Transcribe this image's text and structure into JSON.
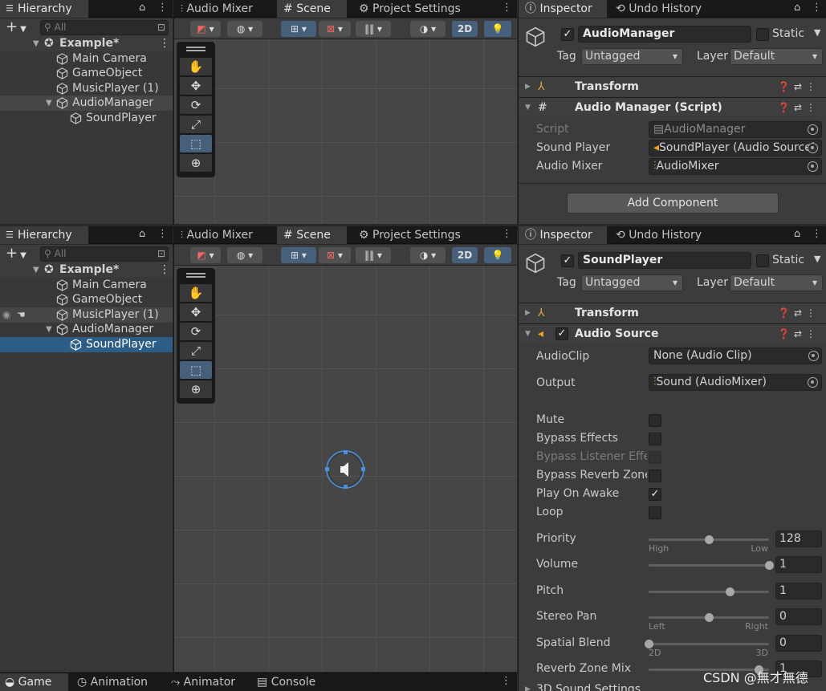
{
  "tabs": {
    "hierarchy": "Hierarchy",
    "audio_mixer": "Audio Mixer",
    "scene": "Scene",
    "project_settings": "Project Settings",
    "inspector": "Inspector",
    "undo_history": "Undo History"
  },
  "hierarchy": {
    "search_placeholder": "All",
    "scene_name": "Example*",
    "items": [
      "Main Camera",
      "GameObject",
      "MusicPlayer (1)",
      "AudioManager",
      "SoundPlayer"
    ]
  },
  "scene_toolbar": {
    "mode_2d": "2D"
  },
  "top_inspector": {
    "object_name": "AudioManager",
    "static_label": "Static",
    "tag_label": "Tag",
    "tag_value": "Untagged",
    "layer_label": "Layer",
    "layer_value": "Default",
    "components": {
      "transform": "Transform",
      "script": "Audio Manager (Script)"
    },
    "props": [
      {
        "label": "Script",
        "value": "AudioManager"
      },
      {
        "label": "Sound Player",
        "value": "SoundPlayer (Audio Source)"
      },
      {
        "label": "Audio Mixer",
        "value": "AudioMixer"
      }
    ],
    "add_component": "Add Component"
  },
  "bottom_inspector": {
    "object_name": "SoundPlayer",
    "static_label": "Static",
    "tag_label": "Tag",
    "tag_value": "Untagged",
    "layer_label": "Layer",
    "layer_value": "Default",
    "components": {
      "transform": "Transform",
      "audio_source": "Audio Source",
      "sound_3d": "3D Sound Settings"
    },
    "audio_clip": {
      "label": "AudioClip",
      "value": "None (Audio Clip)"
    },
    "output": {
      "label": "Output",
      "value": "Sound (AudioMixer)"
    },
    "toggles": [
      {
        "label": "Mute",
        "checked": false
      },
      {
        "label": "Bypass Effects",
        "checked": false
      },
      {
        "label": "Bypass Listener Effects",
        "checked": false
      },
      {
        "label": "Bypass Reverb Zones",
        "checked": false
      },
      {
        "label": "Play On Awake",
        "checked": true
      },
      {
        "label": "Loop",
        "checked": false
      }
    ],
    "sliders": {
      "priority": {
        "label": "Priority",
        "value": "128",
        "fraction": 0.5,
        "min_label": "High",
        "max_label": "Low"
      },
      "volume": {
        "label": "Volume",
        "value": "1",
        "fraction": 1.0
      },
      "pitch": {
        "label": "Pitch",
        "value": "1",
        "fraction": 0.67
      },
      "stereo_pan": {
        "label": "Stereo Pan",
        "value": "0",
        "fraction": 0.5,
        "min_label": "Left",
        "max_label": "Right"
      },
      "spatial_blend": {
        "label": "Spatial Blend",
        "value": "0",
        "fraction": 0.0,
        "min_label": "2D",
        "max_label": "3D"
      },
      "reverb_zone_mix": {
        "label": "Reverb Zone Mix",
        "value": "1",
        "fraction": 0.91
      }
    }
  },
  "bottom_tabs": [
    "Game",
    "Animation",
    "Animator",
    "Console"
  ],
  "watermark": "CSDN @無才無德",
  "colors": {
    "selection": "#2c5d87",
    "tool_active": "#46607c",
    "gizmo": "#4a90e2"
  }
}
